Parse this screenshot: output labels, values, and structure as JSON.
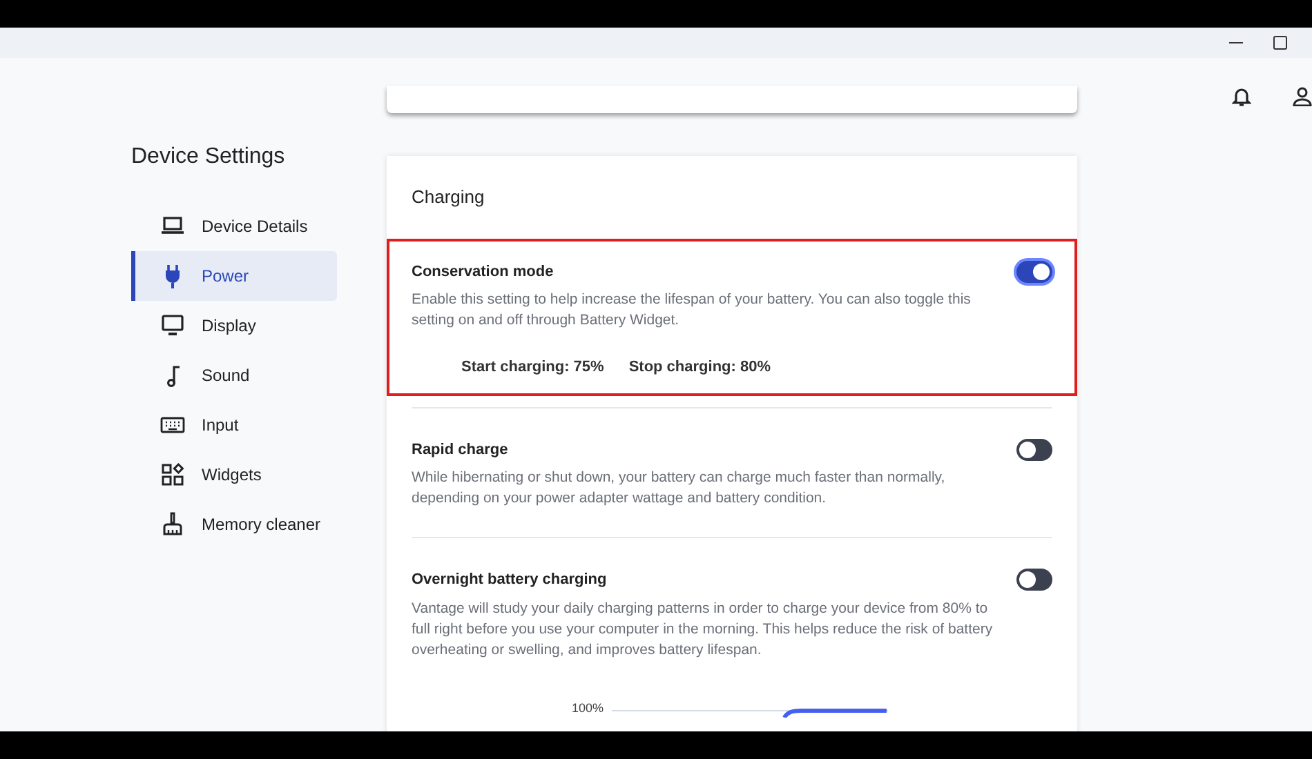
{
  "sidebar": {
    "title": "Device Settings",
    "items": [
      {
        "label": "Device Details",
        "selected": false
      },
      {
        "label": "Power",
        "selected": true
      },
      {
        "label": "Display",
        "selected": false
      },
      {
        "label": "Sound",
        "selected": false
      },
      {
        "label": "Input",
        "selected": false
      },
      {
        "label": "Widgets",
        "selected": false
      },
      {
        "label": "Memory cleaner",
        "selected": false
      }
    ]
  },
  "section": {
    "title": "Charging",
    "settings": [
      {
        "title": "Conservation mode",
        "on": true,
        "highlighted": true,
        "description": "Enable this setting to help increase the lifespan of your battery. You can also toggle this setting on and off through Battery Widget.",
        "readings": [
          "Start charging: 75%",
          "Stop charging: 80%"
        ]
      },
      {
        "title": "Rapid charge",
        "on": false,
        "highlighted": false,
        "description": "While hibernating or shut down, your battery can charge much faster than normally, depending on your power adapter wattage and battery condition."
      },
      {
        "title": "Overnight battery charging",
        "on": false,
        "highlighted": false,
        "description": "Vantage will study your daily charging patterns in order to charge your device from 80% to full right before you use your computer in the morning. This helps reduce the risk of battery overheating or swelling, and improves battery lifespan.",
        "graph_label": "100%"
      }
    ]
  }
}
